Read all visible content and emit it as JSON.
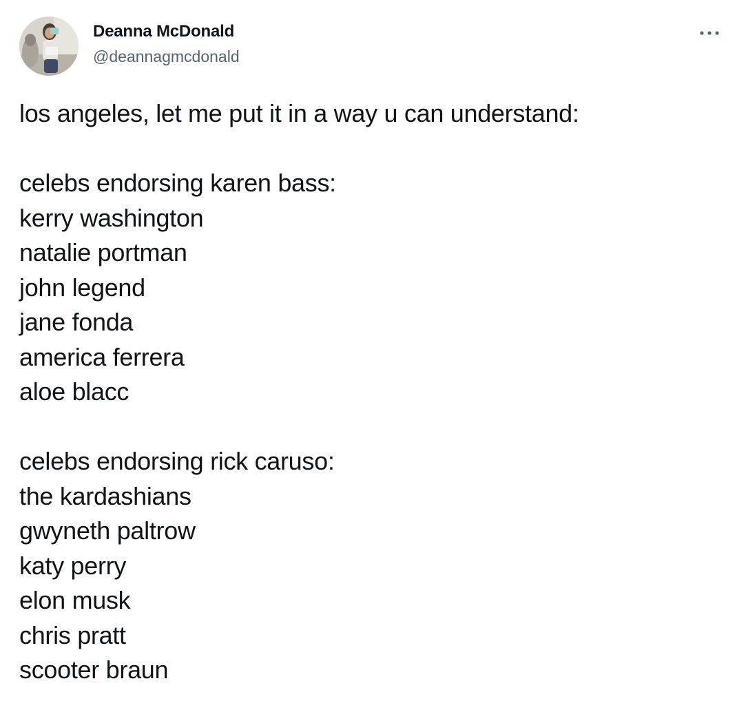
{
  "author": {
    "display_name": "Deanna McDonald",
    "handle": "@deannagmcdonald",
    "avatar_icon": "user-avatar-photo"
  },
  "header": {
    "more_icon": "more-horizontal-icon"
  },
  "tweet": {
    "intro": "los angeles, let me put it in a way u can understand:",
    "group_a": {
      "heading": "celebs endorsing karen bass:",
      "names": [
        "kerry washington",
        "natalie portman",
        "john legend",
        "jane fonda",
        "america ferrera",
        "aloe blacc"
      ]
    },
    "group_b": {
      "heading": "celebs endorsing rick caruso:",
      "names": [
        "the kardashians",
        "gwyneth paltrow",
        "katy perry",
        "elon musk",
        "chris pratt",
        "scooter braun"
      ]
    }
  },
  "colors": {
    "text_primary": "#0f1419",
    "text_secondary": "#536471",
    "background": "#ffffff"
  }
}
